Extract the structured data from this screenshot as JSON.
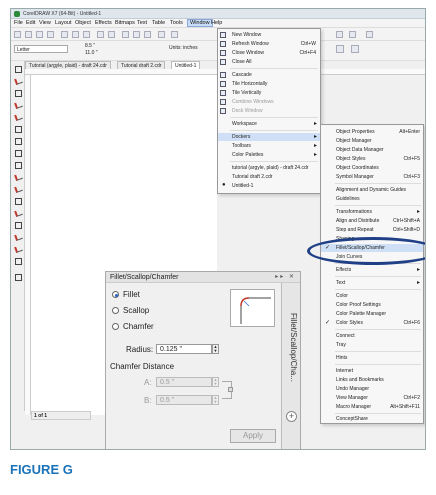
{
  "app": {
    "title": "CorelDRAW X7 (64-Bit) - Untitled-1"
  },
  "menubar": [
    "File",
    "Edit",
    "View",
    "Layout",
    "Object",
    "Effects",
    "Bitmaps",
    "Text",
    "Table",
    "Tools",
    "Window",
    "Help"
  ],
  "propbar": {
    "page_size": "Letter",
    "width": "8.5 \"",
    "height": "11.0 \"",
    "units_label": "Units: inches"
  },
  "doc_tabs": [
    "Tutorial (argyle, plaid) - draft 24.cdr",
    "Tutorial draft 2.cdr",
    "Untitled-1"
  ],
  "window_menu": [
    {
      "label": "New Window",
      "shortcut": ""
    },
    {
      "label": "Refresh Window",
      "shortcut": "Ctrl+W"
    },
    {
      "label": "Close Window",
      "shortcut": "Ctrl+F4"
    },
    {
      "label": "Close All",
      "shortcut": ""
    },
    {
      "label": "Cascade",
      "shortcut": ""
    },
    {
      "label": "Tile Horizontally",
      "shortcut": ""
    },
    {
      "label": "Tile Vertically",
      "shortcut": ""
    },
    {
      "label": "Combine Windows",
      "shortcut": ""
    },
    {
      "label": "Dock Window",
      "shortcut": ""
    },
    {
      "label": "Workspace",
      "shortcut": ""
    },
    {
      "label": "Dockers",
      "shortcut": ""
    },
    {
      "label": "Toolbars",
      "shortcut": ""
    },
    {
      "label": "Color Palettes",
      "shortcut": ""
    },
    {
      "label": "tutorial (argyle, plaid) - draft 24.cdr",
      "shortcut": ""
    },
    {
      "label": "Tutorial draft 2.cdr",
      "shortcut": ""
    },
    {
      "label": "Untitled-1",
      "shortcut": ""
    }
  ],
  "dockers_menu": [
    {
      "label": "Object Properties",
      "shortcut": "Alt+Enter"
    },
    {
      "label": "Object Manager",
      "shortcut": ""
    },
    {
      "label": "Object Data Manager",
      "shortcut": ""
    },
    {
      "label": "Object Styles",
      "shortcut": "Ctrl+F5"
    },
    {
      "label": "Object Coordinates",
      "shortcut": ""
    },
    {
      "label": "Symbol Manager",
      "shortcut": "Ctrl+F3"
    },
    {
      "label": "Alignment and Dynamic Guides",
      "shortcut": ""
    },
    {
      "label": "Guidelines",
      "shortcut": ""
    },
    {
      "label": "Transformations",
      "shortcut": ""
    },
    {
      "label": "Align and Distribute",
      "shortcut": "Ctrl+Shift+A"
    },
    {
      "label": "Step and Repeat",
      "shortcut": "Ctrl+Shift+D"
    },
    {
      "label": "Shaping",
      "shortcut": ""
    },
    {
      "label": "Fillet/Scallop/Chamfer",
      "shortcut": ""
    },
    {
      "label": "Join Curves",
      "shortcut": ""
    },
    {
      "label": "Effects",
      "shortcut": ""
    },
    {
      "label": "Text",
      "shortcut": ""
    },
    {
      "label": "Color",
      "shortcut": ""
    },
    {
      "label": "Color Proof Settings",
      "shortcut": ""
    },
    {
      "label": "Color Palette Manager",
      "shortcut": ""
    },
    {
      "label": "Color Styles",
      "shortcut": "Ctrl+F6"
    },
    {
      "label": "Connect",
      "shortcut": ""
    },
    {
      "label": "Tray",
      "shortcut": ""
    },
    {
      "label": "Hints",
      "shortcut": ""
    },
    {
      "label": "Internet",
      "shortcut": ""
    },
    {
      "label": "Links and Bookmarks",
      "shortcut": ""
    },
    {
      "label": "Undo Manager",
      "shortcut": ""
    },
    {
      "label": "View Manager",
      "shortcut": "Ctrl+F2"
    },
    {
      "label": "Macro Manager",
      "shortcut": "Alt+Shift+F11"
    },
    {
      "label": "ConceptShare",
      "shortcut": ""
    }
  ],
  "docker": {
    "title": "Fillet/Scallop/Chamfer",
    "vertical_tab": "Fillet/Scallop/Cha...",
    "options": [
      "Fillet",
      "Scallop",
      "Chamfer"
    ],
    "radius_label": "Radius:",
    "radius_value": "0.125 \"",
    "chamfer_title": "Chamfer Distance",
    "a_label": "A:",
    "a_value": "0.5 \"",
    "b_label": "B:",
    "b_value": "0.5 \"",
    "apply_label": "Apply"
  },
  "pager": {
    "text": "1 of 1"
  },
  "caption": "FIGURE G"
}
